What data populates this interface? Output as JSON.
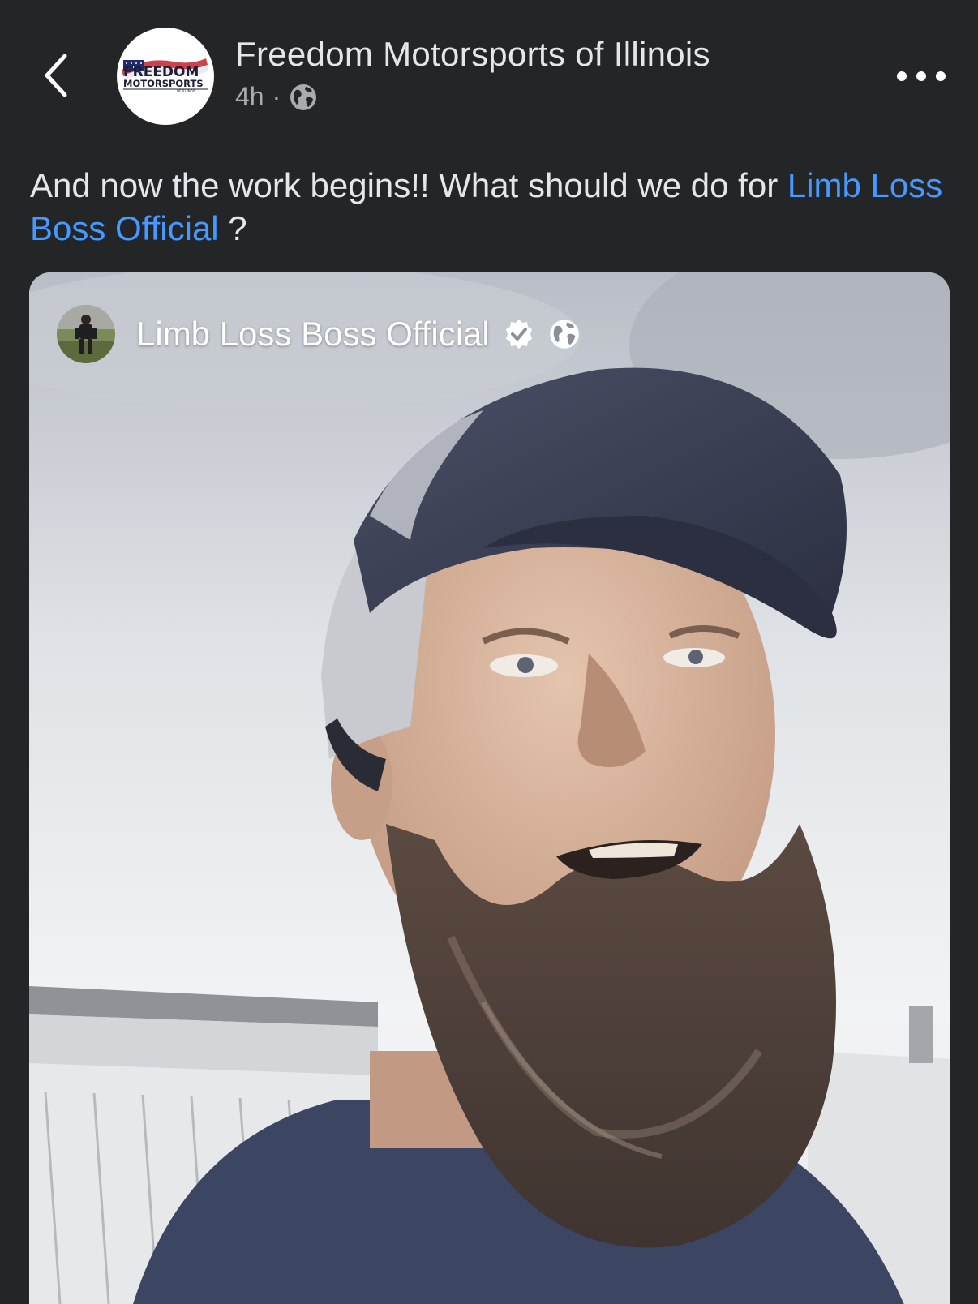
{
  "header": {
    "back_icon": "chevron-left-icon",
    "page_name": "Freedom Motorsports of Illinois",
    "avatar_logo_lines": [
      "FREEDOM",
      "MOTORSPORTS",
      "OF ILLINOIS"
    ],
    "time_ago": "4h",
    "separator": "·",
    "audience_icon": "globe-icon",
    "more_icon": "more-horizontal-icon"
  },
  "post": {
    "text_before": "And now the work begins!! What should we do for ",
    "mention": "Limb Loss Boss Official",
    "text_after": " ?"
  },
  "shared": {
    "author_name": "Limb Loss Boss Official",
    "verified_icon": "verified-badge-icon",
    "audience_icon": "globe-icon",
    "image_description_icon": "video-frame-photo"
  },
  "colors": {
    "background": "#242527",
    "text_primary": "#e4e6eb",
    "text_secondary": "#a8abb0",
    "link": "#4599ff"
  }
}
